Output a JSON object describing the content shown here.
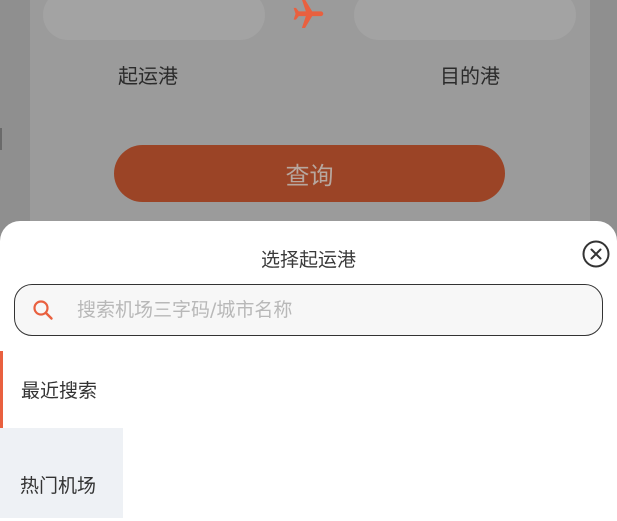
{
  "form": {
    "origin_label": "起运港",
    "destination_label": "目的港",
    "query_label": "查询"
  },
  "sheet": {
    "title": "选择起运港",
    "search_placeholder": "搜索机场三字码/城市名称",
    "nav": [
      {
        "label": "最近搜索",
        "active": true
      },
      {
        "label": "热门机场",
        "active": false
      }
    ]
  },
  "colors": {
    "accent": "#e9603f",
    "button": "#9b4426",
    "nav_bg": "#eef1f5"
  },
  "icons": [
    "airplane-icon",
    "close-icon",
    "search-icon"
  ]
}
